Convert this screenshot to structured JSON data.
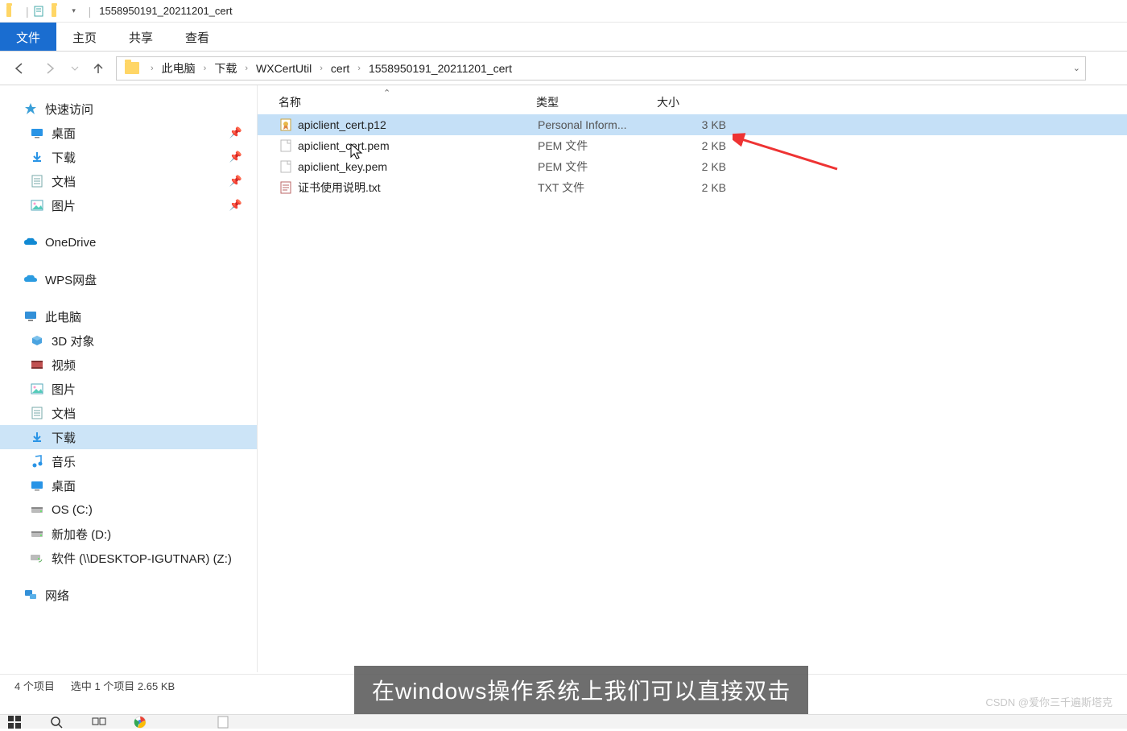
{
  "title": "1558950191_20211201_cert",
  "ribbon": {
    "file": "文件",
    "home": "主页",
    "share": "共享",
    "view": "查看"
  },
  "breadcrumb": [
    "此电脑",
    "下载",
    "WXCertUtil",
    "cert",
    "1558950191_20211201_cert"
  ],
  "columns": {
    "name": "名称",
    "type": "类型",
    "size": "大小"
  },
  "files": [
    {
      "name": "apiclient_cert.p12",
      "type": "Personal Inform...",
      "size": "3 KB",
      "icon": "cert",
      "selected": true
    },
    {
      "name": "apiclient_cert.pem",
      "type": "PEM 文件",
      "size": "2 KB",
      "icon": "file",
      "selected": false
    },
    {
      "name": "apiclient_key.pem",
      "type": "PEM 文件",
      "size": "2 KB",
      "icon": "file",
      "selected": false
    },
    {
      "name": "证书使用说明.txt",
      "type": "TXT 文件",
      "size": "2 KB",
      "icon": "txt",
      "selected": false
    }
  ],
  "sidebar": {
    "quickAccess": "快速访问",
    "quickItems": [
      {
        "label": "桌面",
        "icon": "desktop",
        "pinned": true
      },
      {
        "label": "下载",
        "icon": "download",
        "pinned": true
      },
      {
        "label": "文档",
        "icon": "doc",
        "pinned": true
      },
      {
        "label": "图片",
        "icon": "pic",
        "pinned": true
      }
    ],
    "onedrive": "OneDrive",
    "wps": "WPS网盘",
    "thisPC": "此电脑",
    "pcItems": [
      {
        "label": "3D 对象",
        "icon": "3d"
      },
      {
        "label": "视频",
        "icon": "video"
      },
      {
        "label": "图片",
        "icon": "pic"
      },
      {
        "label": "文档",
        "icon": "doc"
      },
      {
        "label": "下载",
        "icon": "download",
        "selected": true
      },
      {
        "label": "音乐",
        "icon": "music"
      },
      {
        "label": "桌面",
        "icon": "desktop"
      },
      {
        "label": "OS (C:)",
        "icon": "drive"
      },
      {
        "label": "新加卷 (D:)",
        "icon": "drive"
      },
      {
        "label": "软件 (\\\\DESKTOP-IGUTNAR) (Z:)",
        "icon": "netdrive"
      }
    ],
    "network": "网络"
  },
  "status": {
    "items": "4 个项目",
    "selected": "选中 1 个项目  2.65 KB"
  },
  "caption": "在windows操作系统上我们可以直接双击",
  "watermark": "CSDN @爱你三千遍斯塔克"
}
